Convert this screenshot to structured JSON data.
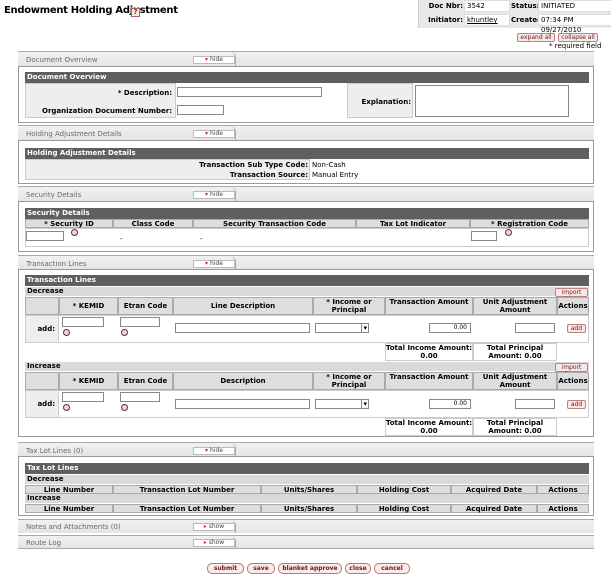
{
  "page": {
    "title": "Endowment Holding Adjustment",
    "help": "?"
  },
  "header": {
    "doc_nbr_label": "Doc Nbr:",
    "doc_nbr": "3542",
    "status_label": "Status:",
    "status": "INITIATED",
    "initiator_label": "Initiator:",
    "initiator": "khuntley",
    "created_label": "Created:",
    "created": "07:34 PM 09/27/2010"
  },
  "top": {
    "expand_all": "expand all",
    "collapse_all": "collapse all",
    "required": "* required field"
  },
  "tabs": {
    "hide": "hide",
    "show": "show",
    "document_overview": "Document Overview",
    "holding_adjustment_details": "Holding Adjustment Details",
    "security_details": "Security Details",
    "transaction_lines": "Transaction Lines",
    "tax_lot_lines": "Tax Lot Lines (0)",
    "notes": "Notes and Attachments (0)",
    "route_log": "Route Log"
  },
  "doc_overview": {
    "header": "Document Overview",
    "description_label": "* Description:",
    "org_doc_label": "Organization Document Number:",
    "explanation_label": "Explanation:"
  },
  "holding": {
    "header": "Holding Adjustment Details",
    "sub_type_label": "Transaction Sub Type Code:",
    "sub_type": "Non-Cash",
    "source_label": "Transaction Source:",
    "source": "Manual Entry"
  },
  "security": {
    "header": "Security Details",
    "cols": [
      "* Security ID",
      "Class Code",
      "Security Transaction Code",
      "Tax Lot Indicator",
      "* Registration Code"
    ],
    "class_code": "-",
    "trans_code": "-"
  },
  "transaction": {
    "header": "Transaction Lines",
    "import_lines": "import lines",
    "add_label": "add:",
    "add_btn": "add",
    "decrease": {
      "label": "Decrease",
      "cols": [
        "* KEMID",
        "Etran Code",
        "Line Description",
        "* Income or Principal",
        "Transaction Amount",
        "Unit Adjustment Amount",
        "Actions"
      ],
      "amount": "0.00",
      "total_income": "Total Income Amount: 0.00",
      "total_principal": "Total Principal Amount: 0.00"
    },
    "increase": {
      "label": "Increase",
      "cols": [
        "* KEMID",
        "Etran Code",
        "Description",
        "* Income or Principal",
        "Transaction Amount",
        "Unit Adjustment Amount",
        "Actions"
      ],
      "amount": "0.00",
      "total_income": "Total Income Amount: 0.00",
      "total_principal": "Total Principal Amount: 0.00"
    }
  },
  "taxlot": {
    "header": "Tax Lot Lines",
    "decrease": "Decrease",
    "increase": "Increase",
    "cols": [
      "Line Number",
      "Transaction Lot Number",
      "Units/Shares",
      "Holding Cost",
      "Acquired Date",
      "Actions"
    ]
  },
  "buttons": {
    "submit": "submit",
    "save": "save",
    "blanket": "blanket approve",
    "close": "close",
    "cancel": "cancel"
  }
}
